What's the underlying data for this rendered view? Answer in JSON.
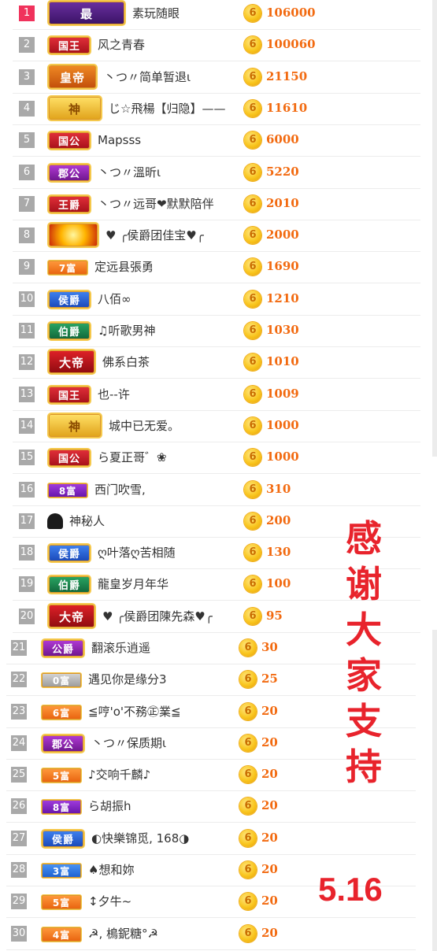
{
  "ranking": [
    {
      "rank": "1",
      "badge": "最",
      "badge_style": "crown-purple",
      "name": "素玩随眼",
      "coin": "6",
      "score": "106000"
    },
    {
      "rank": "2",
      "badge": "国王",
      "badge_style": "red",
      "name": "风之青春",
      "coin": "6",
      "score": "100060"
    },
    {
      "rank": "3",
      "badge": "皇帝",
      "badge_style": "orange-crown",
      "name": "丶つ〃简单暂退ι",
      "coin": "6",
      "score": "21150"
    },
    {
      "rank": "4",
      "badge": "神",
      "badge_style": "gold-crown",
      "name": "じ☆飛楊【归隐】——",
      "coin": "6",
      "score": "11610"
    },
    {
      "rank": "5",
      "badge": "国公",
      "badge_style": "red",
      "name": "Mapsss",
      "coin": "6",
      "score": "6000"
    },
    {
      "rank": "6",
      "badge": "郡公",
      "badge_style": "purple",
      "name": "丶つ〃溫昕ι",
      "coin": "6",
      "score": "5220"
    },
    {
      "rank": "7",
      "badge": "王爵",
      "badge_style": "red",
      "name": "丶つ〃远哥❤默默陪伴",
      "coin": "6",
      "score": "2010"
    },
    {
      "rank": "8",
      "badge": "",
      "badge_style": "fire-gold",
      "name": "♥ ╭侯爵团佳宝♥╭",
      "coin": "6",
      "score": "2000"
    },
    {
      "rank": "9",
      "badge": "7富",
      "badge_style": "orange-small",
      "name": "定远县張勇",
      "coin": "6",
      "score": "1690"
    },
    {
      "rank": "10",
      "badge": "侯爵",
      "badge_style": "blue",
      "name": "八佰∞",
      "coin": "6",
      "score": "1210"
    },
    {
      "rank": "11",
      "badge": "伯爵",
      "badge_style": "green",
      "name": "♫听歌男神",
      "coin": "6",
      "score": "1030"
    },
    {
      "rank": "12",
      "badge": "大帝",
      "badge_style": "red-crown",
      "name": "佛系白茶",
      "coin": "6",
      "score": "1010"
    },
    {
      "rank": "13",
      "badge": "国王",
      "badge_style": "red",
      "name": "也--许",
      "coin": "6",
      "score": "1009"
    },
    {
      "rank": "14",
      "badge": "神",
      "badge_style": "gold-crown",
      "name": "城中已无爱。",
      "coin": "6",
      "score": "1000"
    },
    {
      "rank": "15",
      "badge": "国公",
      "badge_style": "red",
      "name": "ら夏正哥゛❀",
      "coin": "6",
      "score": "1000"
    },
    {
      "rank": "16",
      "badge": "8富",
      "badge_style": "purple-small",
      "name": "西门吹雪,",
      "coin": "6",
      "score": "310"
    },
    {
      "rank": "17",
      "badge": "",
      "badge_style": "mystery",
      "name": "神秘人",
      "coin": "6",
      "score": "200"
    },
    {
      "rank": "18",
      "badge": "侯爵",
      "badge_style": "blue",
      "name": "ღ叶落ღ苦相随",
      "coin": "6",
      "score": "130"
    },
    {
      "rank": "19",
      "badge": "伯爵",
      "badge_style": "green",
      "name": "龍皇岁月年华",
      "coin": "6",
      "score": "100"
    },
    {
      "rank": "20",
      "badge": "大帝",
      "badge_style": "red-crown",
      "name": "♥ ╭侯爵团陳先森♥╭",
      "coin": "6",
      "score": "95"
    },
    {
      "rank": "21",
      "badge": "公爵",
      "badge_style": "purple",
      "name": "翻滚乐逍遥",
      "coin": "6",
      "score": "30"
    },
    {
      "rank": "22",
      "badge": "0富",
      "badge_style": "gray-small",
      "name": "遇见你是缘分3",
      "coin": "6",
      "score": "25"
    },
    {
      "rank": "23",
      "badge": "6富",
      "badge_style": "orange-small",
      "name": "≦哼'o'不務㊣業≦",
      "coin": "6",
      "score": "20"
    },
    {
      "rank": "24",
      "badge": "郡公",
      "badge_style": "purple",
      "name": "丶つ〃保质期ι",
      "coin": "6",
      "score": "20"
    },
    {
      "rank": "25",
      "badge": "5富",
      "badge_style": "orange-small",
      "name": "♪交响千麟♪",
      "coin": "6",
      "score": "20"
    },
    {
      "rank": "26",
      "badge": "8富",
      "badge_style": "purple-small",
      "name": "ら胡振h",
      "coin": "6",
      "score": "20"
    },
    {
      "rank": "27",
      "badge": "侯爵",
      "badge_style": "blue",
      "name": "◐快樂锦觅, 168◑",
      "coin": "6",
      "score": "20"
    },
    {
      "rank": "28",
      "badge": "3富",
      "badge_style": "blue-small",
      "name": "♠想和妳",
      "coin": "6",
      "score": "20"
    },
    {
      "rank": "29",
      "badge": "5富",
      "badge_style": "orange-small",
      "name": "↕夕牛~",
      "coin": "6",
      "score": "20"
    },
    {
      "rank": "30",
      "badge": "4富",
      "badge_style": "orange-small",
      "name": "☭, 樢鈮糖°☭",
      "coin": "6",
      "score": "20"
    }
  ],
  "thanks_text": [
    "感",
    "谢",
    "大",
    "家",
    "支",
    "持"
  ],
  "date_text": "5.16",
  "colors": {
    "rank_first": "#f0325c",
    "rank_default": "#a9a9a9",
    "score": "#f26a10",
    "highlight_text": "#e8232c",
    "coin_gold": "#f9c51e"
  }
}
